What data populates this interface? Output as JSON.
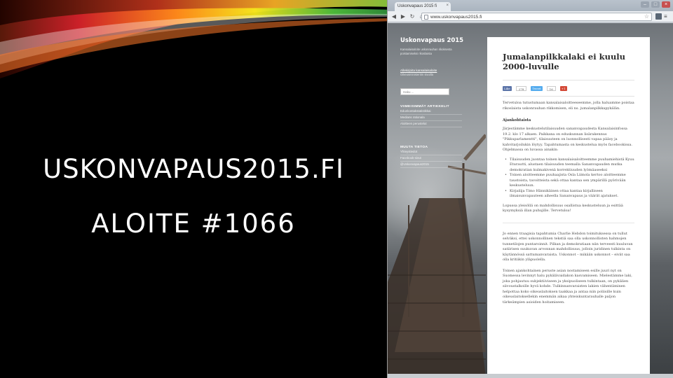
{
  "slide": {
    "title_line1": "USKONVAPAUS2015.FI",
    "title_line2": "ALOITE #1066"
  },
  "browser": {
    "tab_title": "Uskonvapaus 2015 fi",
    "url": "www.uskonvapaus2015.fi",
    "icons": [
      "back-icon",
      "forward-icon",
      "reload-icon",
      "home-icon",
      "page-icon",
      "star-icon",
      "extension-icon",
      "menu-icon"
    ]
  },
  "site": {
    "title": "Uskonvapaus 2015",
    "description": "Kansalaisaloite uskonrauhan rikoksesta poistamiseksi rikoslaista",
    "sign_link": "Allekirjoita kansalaisaloite",
    "sign_sub": "Oikeusministeriön sivuilla",
    "search_placeholder": "Haku ...",
    "recent_heading": "VIIMEISIMMÄT ARTIKKELIT",
    "recent_items": [
      "Edunkontakstatistikkai",
      "Medians rationala",
      "Aloitteen perustelut"
    ],
    "other_heading": "MUUTA TIETOA",
    "other_items": [
      "Yhteystiedot",
      "Facebook-sivut",
      "@Uskonvapaus2015"
    ]
  },
  "article": {
    "title": "Jumalanpilkkalaki ei kuulu 2000-luvulle",
    "share": {
      "fb_label": "Like",
      "fb_count": "278",
      "tw_label": "Tweet",
      "tw_count": "16",
      "g_label": "+1"
    },
    "intro": "Tervetuloa tutustumaan kansalaisaloitteeseemme, jolla haluamme poistaa rikoslaista uskonrauhan rikkomisen, eli ns. jumalanpilkkapykälän.",
    "section_heading": "Ajankohtaista",
    "section_text": "Järjestämme keskustelutilaisuuden sananvapaudesta Kansalaisinfossa 19.2. klo 17 alkaen. Paikkana on eduskunnan lisärakennus \"Pikkuparlamentti\", tilaisuuteen on luonnollisesti vapaa pääsy ja kahvitarjoilukin löytyy. Tapahtumasta on keskustelua myös facebookissa. Ohjelmassa on luvassa ainakin:",
    "bullets": [
      "Tilaisuuden juontaa toinen kansalaisaloitteemme puuhamiehistä Kyuu Eturautti, alustaen tilaisuuden teemalla Sananvapauden mutka demokratian kulmakivenä korrektiuuden lyömäaseeksi",
      "Toinen aloitteemme puuhaajista Osla Liimola kertoo aloitteemme taustoista, tavoitteista sekä ottaa kantaa sen ympärillä pyörivään keskusteluun.",
      "Kirjailija Timo Hännikäinen ottaa kantaa kirjalliseen ilmaisunvapauteen aiheella Sananvapaus ja väärät ajatukset."
    ],
    "closing": "Lopussa yleisöllä on mahdollisuus osallistua keskusteluun ja esittää kysymyksiä illan puhujille. Tervetuloa!",
    "body1": "Jo ennen traagisia tapahtumia Charlie Hebdon toimituksessa on tullut selväksi, ettei uskonnollinen tekstiä saa olla uskonnollisten hahmojen tunnetilojen puntaroinnit. Pilkan ja demokratiaan niin terveesti kuuluvan satiirisen suukuvan arvonnan mahdollisuus, jolloin juridinen tulkinta on käytännössä sattumanvaraista. Uskonnot – mikään uskonnot – eivät saa olla kritiikin yläpuolella.",
    "body2": "Toinen ajankohtainen peruste asian nostamiseen esille juuri nyt on Suomessa levinnyt halu pykälävaidakon kasvamiseen. Mielestämme laki, joka pohjautuu subjektiiviseen ja yksipuoliseen tulkintaan, on pykälien siivoustalkoille hyvä kohde. Tulkinnanvaraisten lakien vähentäminen helpottaa koko oikeuslaitoksen taakkaa ja antaa niin poliisille kuin oikeuslaitoksellekin enemmän aikaa yhteiskuntarauhalle paljon tärkeämpien asioiden hoitamiseen."
  }
}
